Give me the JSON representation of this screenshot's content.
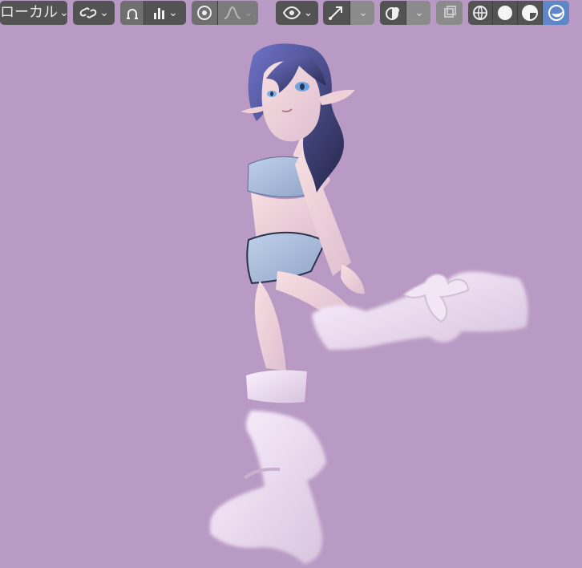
{
  "header": {
    "transform_orientation": {
      "label": "ローカル",
      "chevron": "⌄",
      "icon": "chevron-down-icon"
    },
    "snap": {
      "chevron": "⌄",
      "icon": "link-icon"
    },
    "proportional_edit": {
      "icon": "magnet-icon",
      "chevron": "⌄"
    },
    "bar_icon": {
      "icon": "bars-icon",
      "chevron": "⌄"
    },
    "pivot": {
      "icon": "target-icon",
      "chevron": "⌄"
    },
    "falloff": {
      "icon": "curve-icon",
      "chevron": "⌄"
    },
    "view_mode": {
      "icon": "eye-icon",
      "chevron": "⌄"
    },
    "gizmo": {
      "icon": "arrow-icon",
      "chevron": "⌄"
    },
    "overlay": {
      "icon": "overlay-icon",
      "chevron": "⌄"
    },
    "toggle_xray": {
      "icon": "xray-icon"
    },
    "shading": {
      "wireframe_icon": "globe-icon",
      "solid_icon": "circle-icon",
      "material_icon": "half-circle-icon",
      "rendered_icon": "render-icon"
    }
  },
  "scene": {
    "background_color": "#b99ac4",
    "character": "3d-character"
  }
}
